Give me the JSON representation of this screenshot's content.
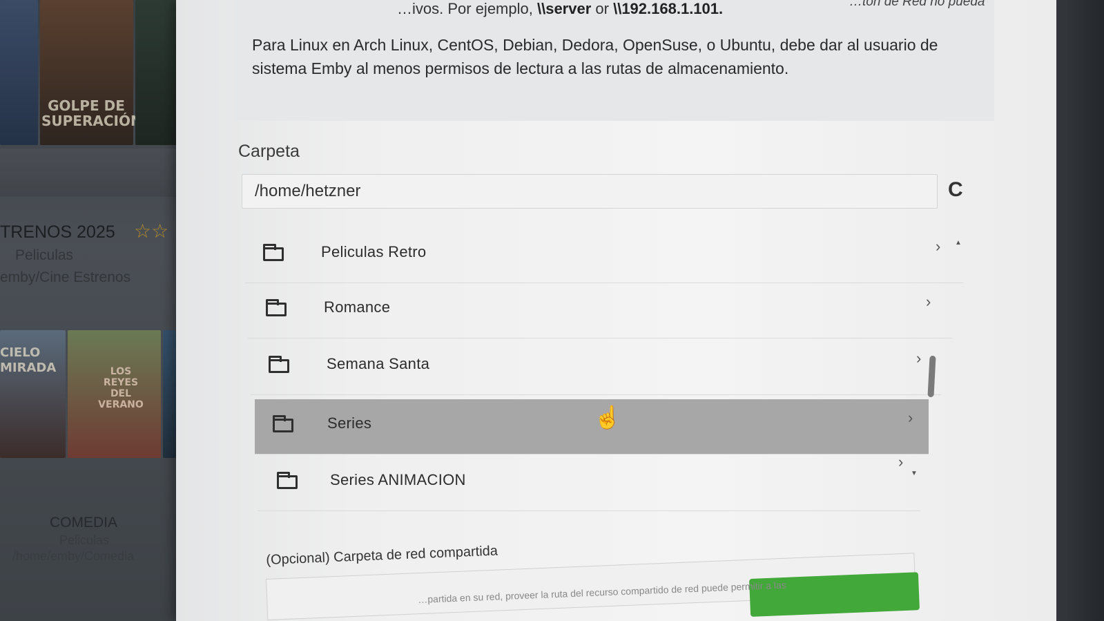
{
  "background": {
    "posters": [
      {
        "title": "GOLPE DE SUPERACIÓN"
      },
      {
        "title": "CIELO MIRADA"
      },
      {
        "title": "LOS REYES DEL VERANO"
      }
    ],
    "libraries": [
      {
        "name": "TRENOS 2025",
        "type": "Peliculas",
        "path": "emby/Cine Estrenos"
      },
      {
        "name": "COMEDIA",
        "type": "Peliculas",
        "path": "/home/emby/Comedia"
      }
    ],
    "stars": "☆☆"
  },
  "dialog": {
    "top_text_prefix": "…ivos. Por ejemplo,",
    "top_text_server": "\\\\server",
    "top_text_or": "or",
    "top_text_ip": "\\\\192.168.1.101.",
    "top_right_text": "…tón de Red no pueda",
    "linux_note": "Para Linux en Arch Linux, CentOS, Debian, Dedora, OpenSuse, o Ubuntu, debe dar al usuario de sistema Emby al menos permisos de lectura a las rutas de almacenamiento.",
    "folder_label": "Carpeta",
    "folder_value": "/home/hetzner",
    "refresh_icon": "C",
    "folders": [
      {
        "label": "Peliculas Retro"
      },
      {
        "label": "Romance"
      },
      {
        "label": "Semana Santa"
      },
      {
        "label": "Series"
      },
      {
        "label": "Series ANIMACION"
      }
    ],
    "chevron": "›",
    "selected_folder": "Series",
    "optional_label": "(Opcional) Carpeta de red compartida",
    "share_help_text": "…partida en su red, proveer la ruta del recurso compartido de red puede permitir a las",
    "accent_color": "#43a83a"
  }
}
